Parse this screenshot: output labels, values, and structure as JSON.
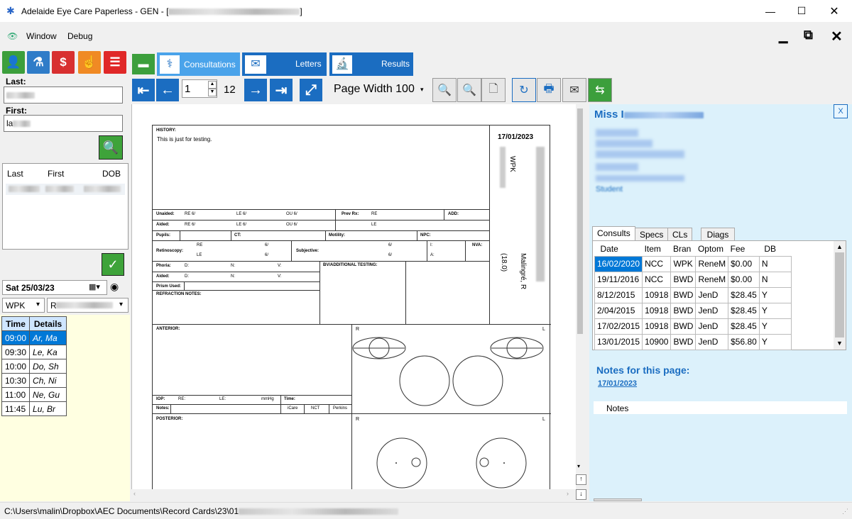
{
  "titlebar": {
    "app_title": "Adelaide Eye Care Paperless - GEN - [",
    "title_suffix": "]"
  },
  "menu": {
    "window": "Window",
    "debug": "Debug"
  },
  "search": {
    "last_label": "Last:",
    "first_label": "First:",
    "first_value": "la"
  },
  "results": {
    "columns": [
      "Last",
      "First",
      "DOB"
    ]
  },
  "date_bar": {
    "date": "Sat  25/03/23",
    "location": "WPK"
  },
  "appointments": {
    "headers": [
      "Time",
      "Details"
    ],
    "rows": [
      {
        "time": "09:00",
        "details": "Ar, Ma"
      },
      {
        "time": "09:30",
        "details": "Le, Ka"
      },
      {
        "time": "10:00",
        "details": "Do, Sh"
      },
      {
        "time": "10:30",
        "details": "Ch, Ni"
      },
      {
        "time": "11:00",
        "details": "Ne, Gu"
      },
      {
        "time": "11:45",
        "details": "Lu, Br"
      }
    ]
  },
  "tabs": {
    "consultations": "Consultations",
    "letters": "Letters",
    "results": "Results"
  },
  "toolbar": {
    "page": "1",
    "total_pages": "12",
    "zoom": "Page Width 100"
  },
  "document": {
    "history_label": "HISTORY:",
    "history_text": "This is just for testing.",
    "date": "17/01/2023",
    "site": "WPK",
    "patient_name": "Malingré, R",
    "age": "(18.0)",
    "unaided": "Unaided:",
    "aided": "Aided:",
    "re6": "RE 6/",
    "le6": "LE 6/",
    "ou6": "OU 6/",
    "prev_rx": "Prev Rx:",
    "re": "RE",
    "le": "LE",
    "add": "ADD:",
    "pupils": "Pupils:",
    "ct": "CT:",
    "motility": "Motility:",
    "npc": "NPC:",
    "retinoscopy": "Retinoscopy:",
    "subjective": "Subjective:",
    "six": "6/",
    "i": "I:",
    "a": "A:",
    "nva": "NVA:",
    "phoria": "Phoria:",
    "aided2": "Aided:",
    "d": "D:",
    "n": "N:",
    "v": "V:",
    "prism": "Prism Used:",
    "refraction_notes": "REFRACTION NOTES:",
    "bv": "BV/ADDITIONAL TESTING:",
    "anterior": "ANTERIOR:",
    "r": "R",
    "l": "L",
    "iop": "IOP:",
    "re_colon": "RE:",
    "le_colon": "LE:",
    "mmhg": "mmHg",
    "time": "Time:",
    "notes": "Notes:",
    "icare": "iCare",
    "nct": "NCT",
    "perkins": "Perkins",
    "posterior": "POSTERIOR:"
  },
  "patient": {
    "title_prefix": "Miss I",
    "status": "Student",
    "close": "X"
  },
  "patient_tabs": [
    "Consults",
    "Specs",
    "CLs",
    "Diags"
  ],
  "consults": {
    "headers": [
      "Date",
      "Item",
      "Bran",
      "Optom",
      "Fee",
      "DB"
    ],
    "rows": [
      [
        "16/02/2020",
        "NCC",
        "WPK",
        "ReneM",
        "$0.00",
        "N"
      ],
      [
        "19/11/2016",
        "NCC",
        "BWD",
        "ReneM",
        "$0.00",
        "N"
      ],
      [
        "8/12/2015",
        "10918",
        "BWD",
        "JenD",
        "$28.45",
        "Y"
      ],
      [
        "2/04/2015",
        "10918",
        "BWD",
        "JenD",
        "$28.45",
        "Y"
      ],
      [
        "17/02/2015",
        "10918",
        "BWD",
        "JenD",
        "$28.45",
        "Y"
      ],
      [
        "13/01/2015",
        "10900",
        "BWD",
        "JenD",
        "$56.80",
        "Y"
      ]
    ]
  },
  "notes_panel": {
    "heading": "Notes for this page:",
    "date_link": "17/01/2023",
    "notes_col": "Notes"
  },
  "statusbar": {
    "path": "C:\\Users\\malin\\Dropbox\\AEC Documents\\Record Cards\\23\\01"
  },
  "colors": {
    "accent": "#1b6dc1",
    "panel": "#dcf1fb",
    "selected_row": "#0078d7",
    "appt_bg": "#ffffe1"
  }
}
